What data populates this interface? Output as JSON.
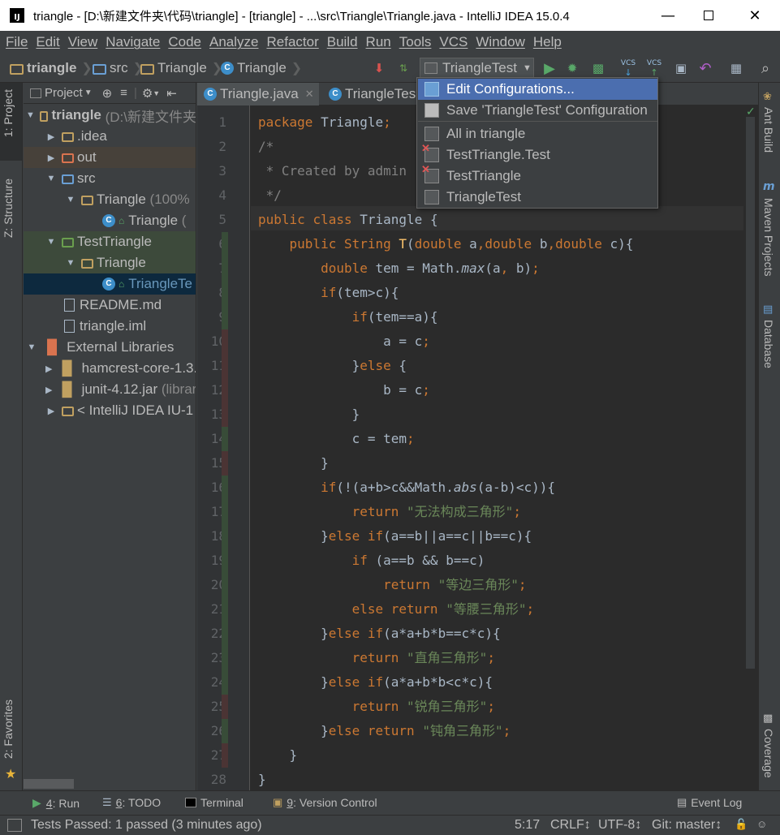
{
  "window": {
    "title": "triangle - [D:\\新建文件夹\\代码\\triangle] - [triangle] - ...\\src\\Triangle\\Triangle.java - IntelliJ IDEA 15.0.4",
    "app_icon": "IJ"
  },
  "menu": [
    "File",
    "Edit",
    "View",
    "Navigate",
    "Code",
    "Analyze",
    "Refactor",
    "Build",
    "Run",
    "Tools",
    "VCS",
    "Window",
    "Help"
  ],
  "breadcrumbs": [
    "triangle",
    "src",
    "Triangle",
    "Triangle"
  ],
  "run_config": "TriangleTest",
  "left_tabs": {
    "project": "1: Project",
    "structure": "Z: Structure",
    "favorites": "2: Favorites"
  },
  "right_tabs": {
    "ant": "Ant Build",
    "maven": "Maven Projects",
    "database": "Database",
    "coverage": "Coverage"
  },
  "project_panel": {
    "header": "Project"
  },
  "tree": [
    {
      "label": "triangle",
      "extra": "(D:\\新建文件夹",
      "bold": true
    },
    {
      "label": ".idea"
    },
    {
      "label": "out"
    },
    {
      "label": "src"
    },
    {
      "label": "Triangle",
      "extra": "(100%"
    },
    {
      "label": "Triangle",
      "extra": "("
    },
    {
      "label": "TestTriangle"
    },
    {
      "label": "Triangle"
    },
    {
      "label": "TriangleTe"
    },
    {
      "label": "README.md"
    },
    {
      "label": "triangle.iml"
    },
    {
      "label": "External Libraries"
    },
    {
      "label": "hamcrest-core-1.3."
    },
    {
      "label": "junit-4.12.jar",
      "extra": "(librar"
    },
    {
      "label": "< IntelliJ IDEA IU-1"
    }
  ],
  "editor_tabs": [
    "Triangle.java",
    "TriangleTes"
  ],
  "line_numbers": [
    "1",
    "2",
    "3",
    "4",
    "5",
    "6",
    "7",
    "8",
    "9",
    "10",
    "11",
    "12",
    "13",
    "14",
    "15",
    "16",
    "17",
    "18",
    "19",
    "20",
    "21",
    "22",
    "23",
    "24",
    "25",
    "26",
    "27",
    "28"
  ],
  "code": [
    "package Triangle;",
    "/*",
    " * Created by admin",
    " */",
    "public class Triangle {",
    "    public String T(double a,double b,double c){",
    "        double tem = Math.max(a, b);",
    "        if(tem>c){",
    "            if(tem==a){",
    "                a = c;",
    "            }else {",
    "                b = c;",
    "            }",
    "            c = tem;",
    "        }",
    "        if(!(a+b>c&&Math.abs(a-b)<c)){",
    "            return \"无法构成三角形\";",
    "        }else if(a==b||a==c||b==c){",
    "            if (a==b && b==c)",
    "                return \"等边三角形\";",
    "            else return \"等腰三角形\";",
    "        }else if(a*a+b*b==c*c){",
    "            return \"直角三角形\";",
    "        }else if(a*a+b*b<c*c){",
    "            return \"锐角三角形\";",
    "        }else return \"钝角三角形\";",
    "    }",
    "}"
  ],
  "popup": {
    "items": [
      "Edit Configurations...",
      "Save 'TriangleTest' Configuration",
      "All in triangle",
      "TestTriangle.Test",
      "TestTriangle",
      "TriangleTest"
    ]
  },
  "bottom_tabs": [
    {
      "key": "4",
      "label": ": Run"
    },
    {
      "key": "6",
      "label": ": TODO"
    },
    {
      "key": "",
      "label": "Terminal"
    },
    {
      "key": "9",
      "label": ": Version Control"
    },
    {
      "key": "",
      "label": "Event Log"
    }
  ],
  "status": {
    "message": "Tests Passed: 1 passed (3 minutes ago)",
    "position": "5:17",
    "line_sep": "CRLF",
    "encoding": "UTF-8",
    "vcs": "Git: master"
  }
}
